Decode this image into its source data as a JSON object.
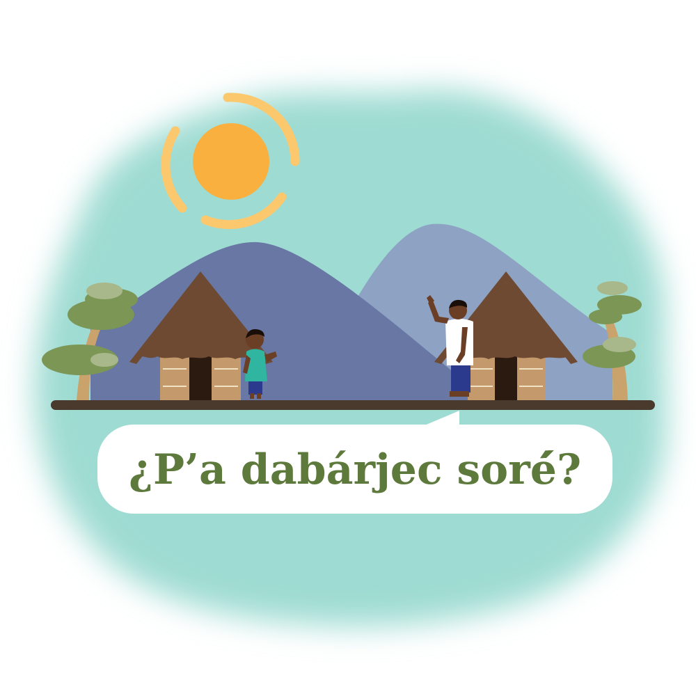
{
  "caption": {
    "text": "¿P’a dabárjec soré́?"
  },
  "colors": {
    "background": "#ffffff",
    "watercolor_wash": "#9edbd2",
    "sun": "#f9b03f",
    "sun_rays": "#fbc86e",
    "mountain_dark": "#6877a3",
    "mountain_light": "#8ea2c4",
    "hut_roof": "#6e4a33",
    "hut_wall": "#c49a6c",
    "hut_door": "#2b1a10",
    "ground": "#4a3a2e",
    "tree_foliage": "#7c9656",
    "tree_foliage_light": "#a8b88a",
    "tree_trunk": "#c9a36b",
    "bubble_fill": "#ffffff",
    "caption_text": "#5d7a3c",
    "boy_shirt": "#2fb5a0",
    "man_shirt": "#ffffff",
    "pants": "#2b3a8c",
    "skin": "#6b3e26"
  },
  "figures": {
    "left": "boy-figure",
    "right": "waving-man-figure"
  }
}
